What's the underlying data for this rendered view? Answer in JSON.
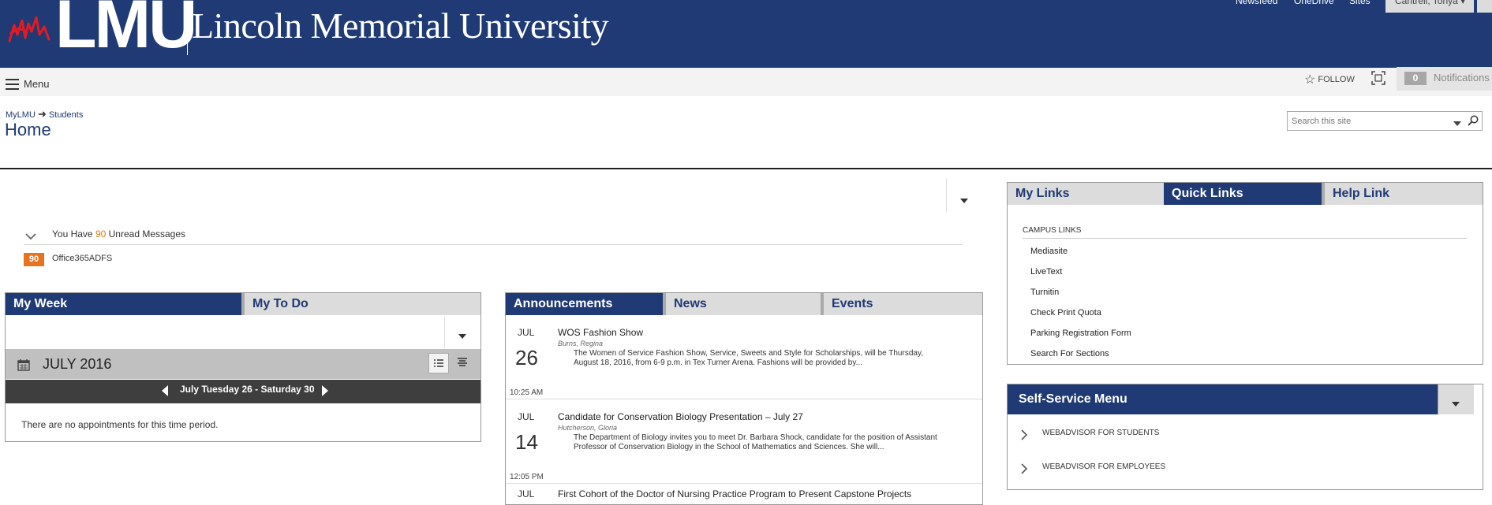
{
  "header": {
    "logo_text": "LMU",
    "university_name": "Lincoln Memorial University",
    "top_links": [
      "Newsfeed",
      "OneDrive",
      "Sites"
    ],
    "user_name": "Cantrell, Tonya",
    "brand_color": "#1f3a74"
  },
  "ribbon": {
    "menu_label": "Menu",
    "follow_label": "FOLLOW",
    "notification_count": "0",
    "notification_label": "Notifications"
  },
  "breadcrumb": {
    "root": "MyLMU",
    "child": "Students"
  },
  "page_title": "Home",
  "search": {
    "placeholder": "Search this site"
  },
  "messages": {
    "prefix": "You Have ",
    "count": "90",
    "suffix": " Unread Messages",
    "source_count": "90",
    "source_name": "Office365ADFS",
    "accent_color": "#e8731f"
  },
  "my_week": {
    "tabs": [
      "My Week",
      "My To Do"
    ],
    "month_label": "JULY 2016",
    "week_range": "July Tuesday 26 - Saturday 30",
    "empty_text": "There are no appointments for this time period."
  },
  "announcements": {
    "tabs": [
      "Announcements",
      "News",
      "Events"
    ],
    "items": [
      {
        "month": "JUL",
        "day": "26",
        "time": "10:25 AM",
        "title": "WOS Fashion Show",
        "author": "Burns, Regina",
        "body": "The Women of Service Fashion Show, Service, Sweets and Style for Scholarships, will be Thursday, August 18, 2016, from 6-9 p.m. in Tex Turner Arena.  Fashions will be provided by..."
      },
      {
        "month": "JUL",
        "day": "14",
        "time": "12:05 PM",
        "title": "Candidate for Conservation Biology Presentation – July 27",
        "author": "Hutcherson, Gloria",
        "body": "The Department of Biology invites you to meet Dr. Barbara Shock, candidate for the position of Assistant Professor of Conservation Biology in the School of Mathematics and Sciences. She will..."
      },
      {
        "month": "JUL",
        "title": "First Cohort of the Doctor of Nursing Practice Program to Present Capstone Projects"
      }
    ]
  },
  "links": {
    "tabs": [
      "My Links",
      "Quick Links",
      "Help Link"
    ],
    "section_label": "CAMPUS LINKS",
    "items": [
      "Mediasite",
      "LiveText",
      "Turnitin",
      "Check Print Quota",
      "Parking Registration Form",
      "Search For Sections"
    ]
  },
  "self_service": {
    "title": "Self-Service Menu",
    "items": [
      "WEBADVISOR FOR STUDENTS",
      "WEBADVISOR FOR EMPLOYEES"
    ]
  }
}
